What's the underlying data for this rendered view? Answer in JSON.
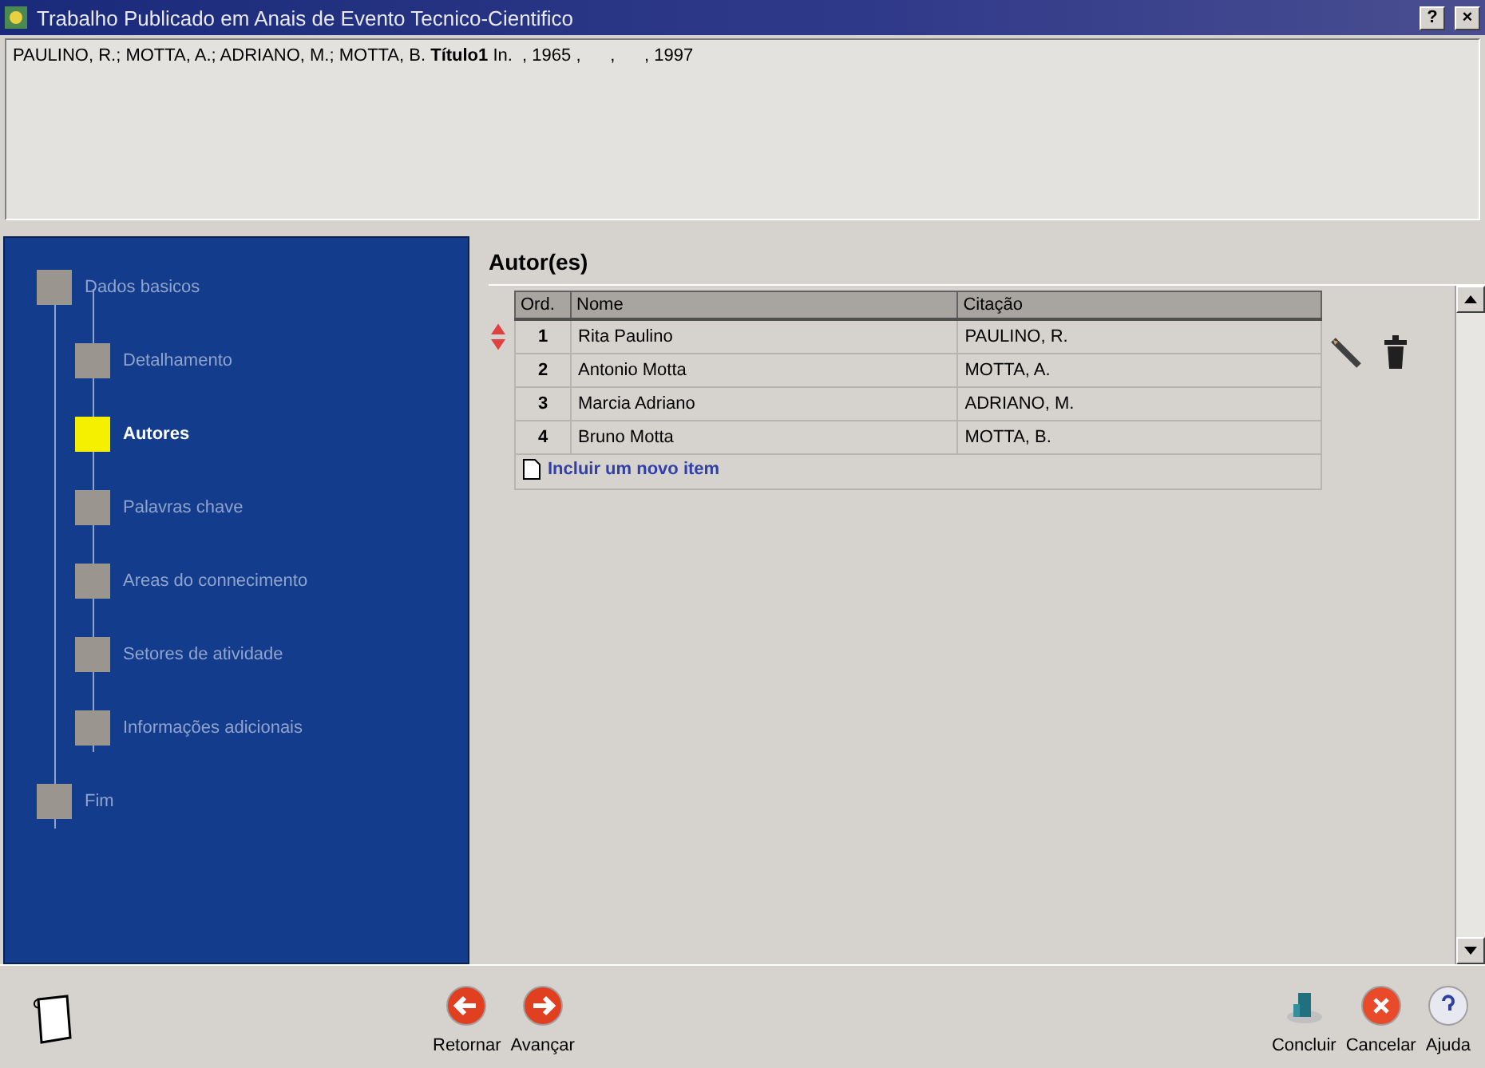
{
  "window": {
    "title": "Trabalho Publicado em Anais de Evento Tecnico-Cientifico",
    "help_button": "?",
    "close_button": "×"
  },
  "reference": "PAULINO, R.; MOTTA, A.; ADRIANO, M.; MOTTA, B. **Título1** In.  , 1965 ,      ,      , 1997",
  "steps": [
    {
      "label": "Dados basicos",
      "selected": false,
      "children": [
        {
          "label": "Detalhamento",
          "selected": false
        },
        {
          "label": "Autores",
          "selected": true
        },
        {
          "label": "Palavras chave",
          "selected": false
        },
        {
          "label": "Areas do connecimento",
          "selected": false
        },
        {
          "label": "Setores de atividade",
          "selected": false
        },
        {
          "label": "Informações adicionais",
          "selected": false
        }
      ]
    },
    {
      "label": "Fim",
      "selected": false
    }
  ],
  "section_title": "Autor(es)",
  "table": {
    "columns": [
      "Ord.",
      "Nome",
      "Citação"
    ],
    "rows": [
      {
        "cells": [
          "1",
          "Rita Paulino",
          "PAULINO, R."
        ],
        "selected": true
      },
      {
        "cells": [
          "2",
          "Antonio Motta",
          "MOTTA, A."
        ],
        "selected": false
      },
      {
        "cells": [
          "3",
          "Marcia Adriano",
          "ADRIANO, M."
        ],
        "selected": false
      },
      {
        "cells": [
          "4",
          "Bruno Motta",
          "MOTTA, B."
        ],
        "selected": false
      }
    ],
    "add_link": "Incluir um novo item"
  },
  "nav_buttons": [
    {
      "label": "Retornar",
      "kind": "back"
    },
    {
      "label": "Avançar",
      "kind": "forward"
    }
  ],
  "action_buttons": [
    {
      "label": "Concluir",
      "kind": "finish"
    },
    {
      "label": "Cancelar",
      "kind": "cancel"
    },
    {
      "label": "Ajuda",
      "kind": "help"
    }
  ]
}
